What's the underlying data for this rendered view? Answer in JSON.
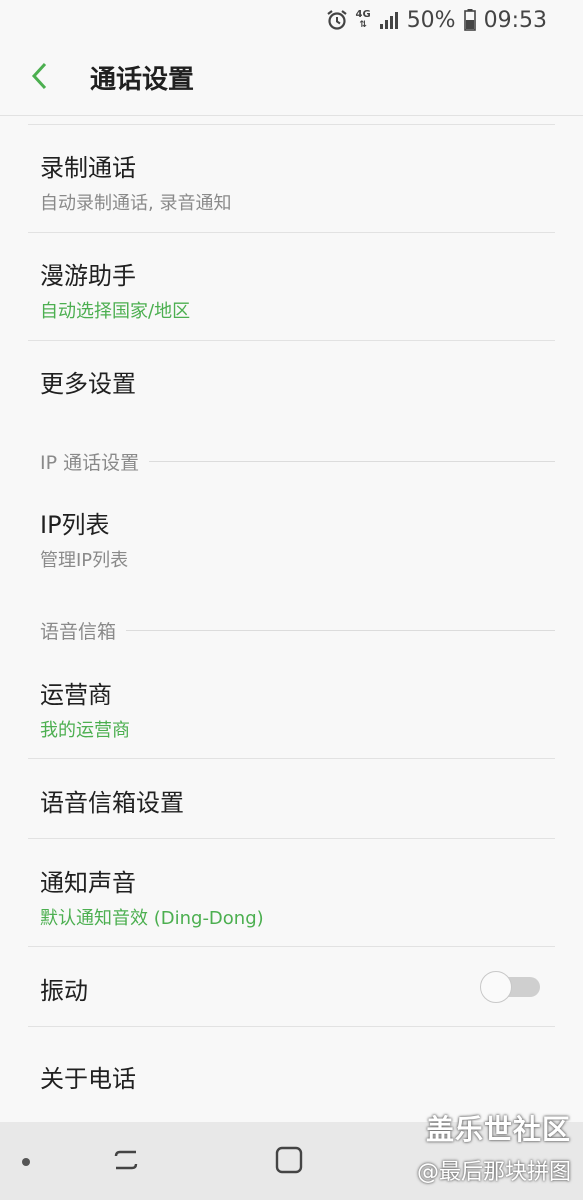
{
  "status_bar": {
    "network": "4G",
    "battery": "50%",
    "time": "09:53",
    "icons": [
      "alarm-icon",
      "network-4g-icon",
      "signal-icon",
      "battery-icon"
    ]
  },
  "header": {
    "title": "通话设置",
    "back_icon": "chevron-left-icon"
  },
  "items": {
    "record": {
      "label": "录制通话",
      "sub": "自动录制通话, 录音通知"
    },
    "roaming": {
      "label": "漫游助手",
      "sub": "自动选择国家/地区"
    },
    "more": {
      "label": "更多设置"
    },
    "ip_list": {
      "label": "IP列表",
      "sub": "管理IP列表"
    },
    "carrier": {
      "label": "运营商",
      "sub": "我的运营商"
    },
    "voicemail_settings": {
      "label": "语音信箱设置"
    },
    "notify_sound": {
      "label": "通知声音",
      "sub": "默认通知音效 (Ding-Dong)"
    },
    "vibrate": {
      "label": "振动",
      "toggle_on": false
    },
    "about": {
      "label": "关于电话"
    }
  },
  "sections": {
    "ip_call": "IP 通话设置",
    "voicemail": "语音信箱"
  },
  "watermark": {
    "line1": "盖乐世社区",
    "line2": "@最后那块拼图"
  },
  "colors": {
    "accent": "#4caf50",
    "background": "#f8f8f8",
    "secondary_text": "#8a8a8a"
  }
}
